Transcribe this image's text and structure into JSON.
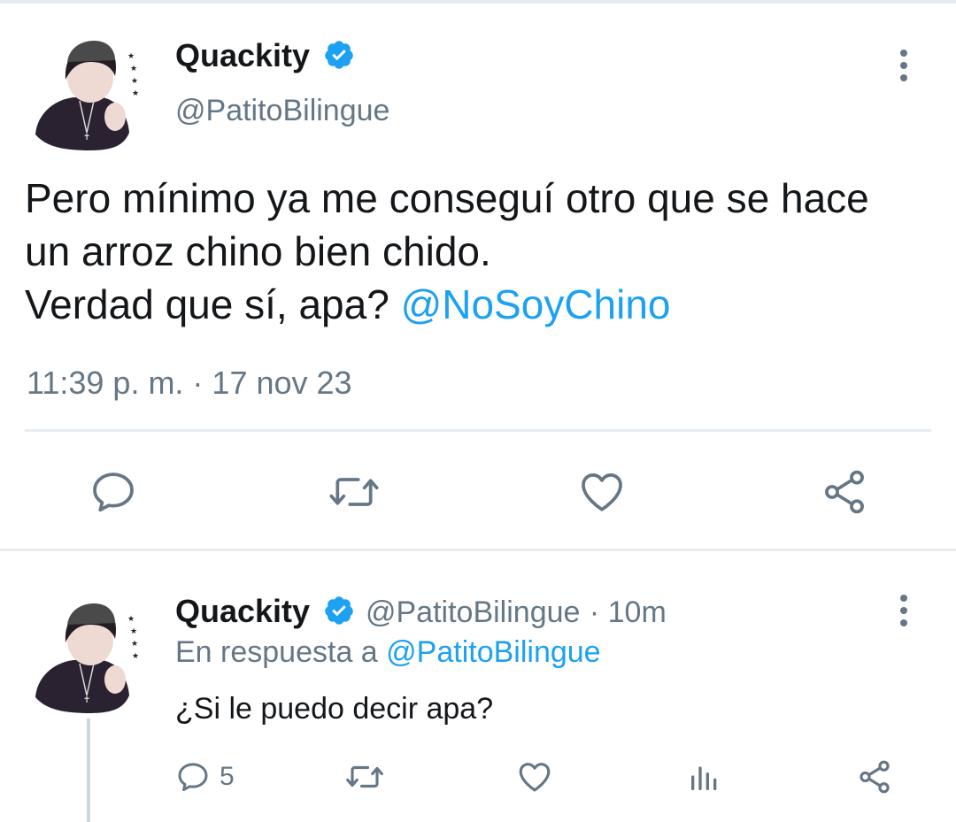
{
  "main_tweet": {
    "author_name": "Quackity",
    "author_handle": "@PatitoBilingue",
    "text_line1": "Pero mínimo ya me conseguí otro que se hace",
    "text_line2": "un arroz chino bien chido.",
    "text_line3": "Verdad que sí, apa?",
    "mention": "@NoSoyChino",
    "timestamp": "11:39 p. m. · 17 nov 23",
    "actions": [
      "reply-icon",
      "retweet-icon",
      "like-icon",
      "share-icon"
    ]
  },
  "reply_tweet": {
    "author_name": "Quackity",
    "author_handle": "@PatitoBilingue",
    "time_ago": "· 10m",
    "replying_prefix": "En respuesta a",
    "replying_to": "@PatitoBilingue",
    "text": "¿Si le puedo decir apa?",
    "reply_count": "5",
    "actions": [
      "reply-icon",
      "retweet-icon",
      "like-icon",
      "analytics-icon",
      "share-icon"
    ]
  },
  "colors": {
    "accent": "#1da1f2",
    "muted": "#657786",
    "divider": "#e6ecf0"
  }
}
